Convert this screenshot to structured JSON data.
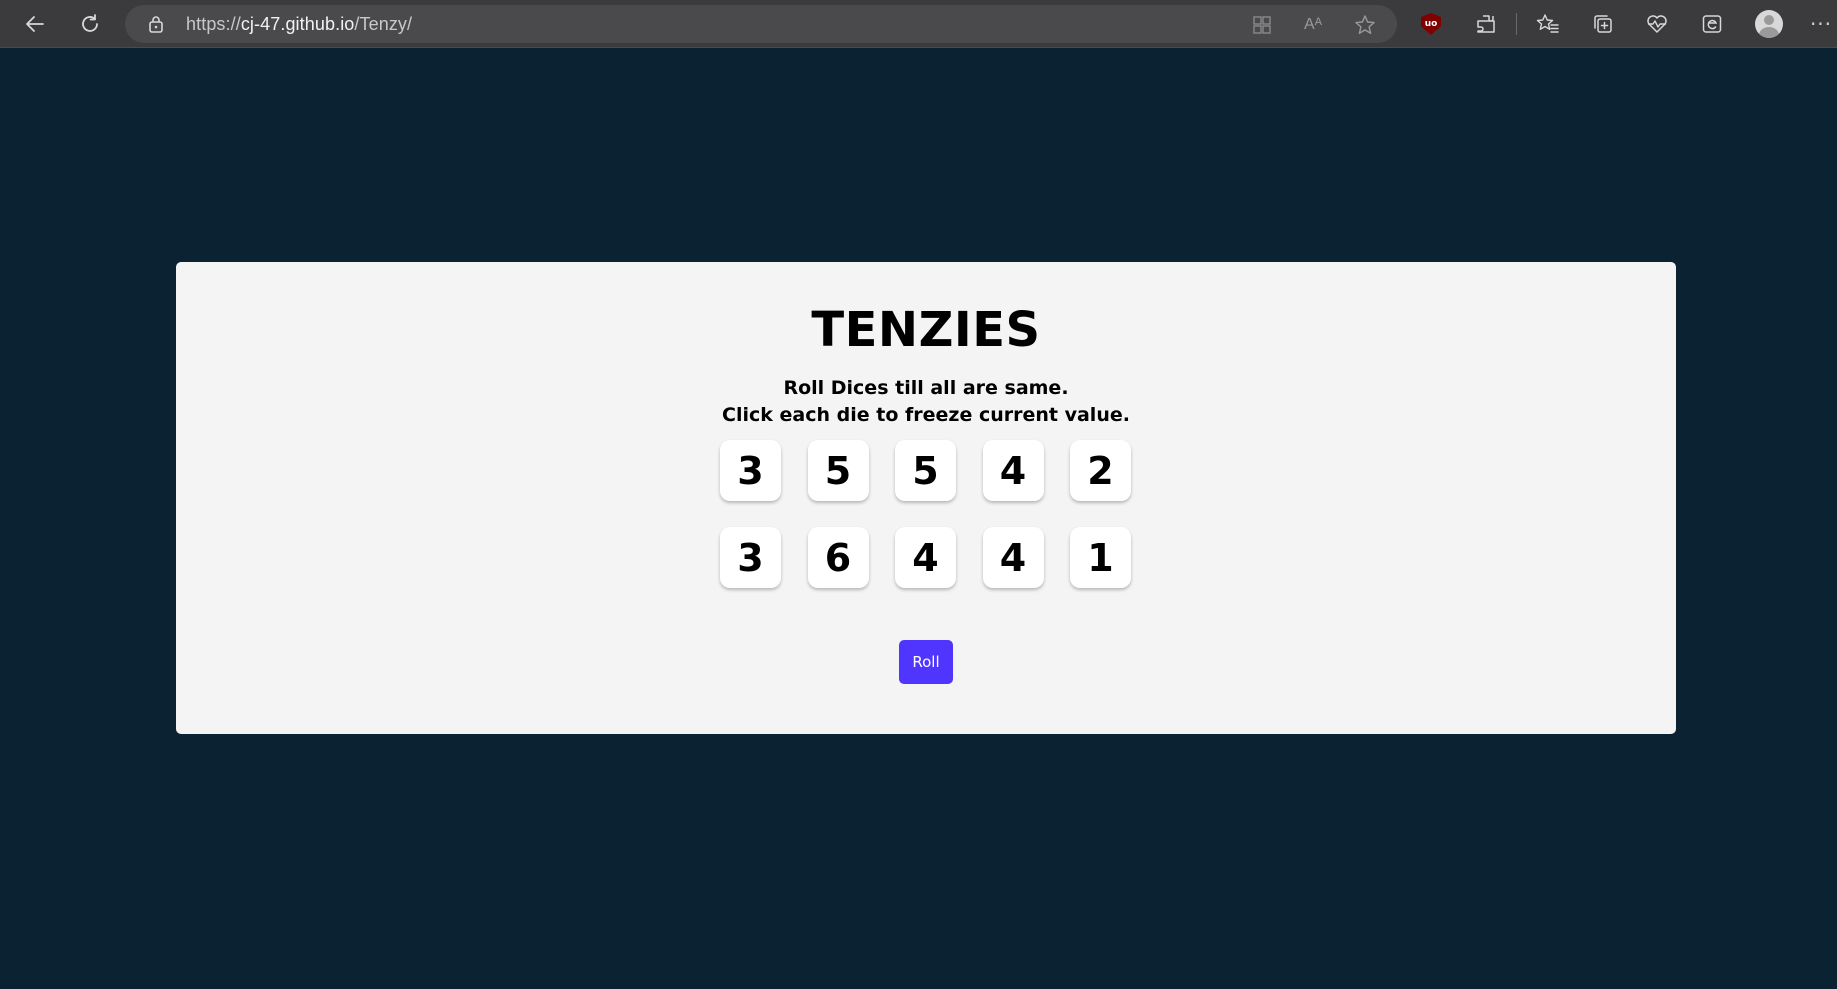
{
  "browser": {
    "url_scheme": "https://",
    "url_host": "cj-47.github.io",
    "url_path": "/Tenzy/",
    "read_aloud_label": "Aᴬ",
    "ublock_label": "uo",
    "more_label": "···",
    "icons": [
      "back-icon",
      "refresh-icon",
      "lock-icon",
      "apps-icon",
      "read-aloud-icon",
      "favorite-star-icon",
      "ublock-icon",
      "extensions-icon",
      "favorites-icon",
      "collections-icon",
      "browser-essentials-icon",
      "edge-bar-icon",
      "profile-icon",
      "more-icon"
    ]
  },
  "app": {
    "title": "TENZIES",
    "instructions_line1": "Roll Dices till all are same.",
    "instructions_line2": "Click each die to freeze current value.",
    "dice": [
      "3",
      "5",
      "5",
      "4",
      "2",
      "3",
      "6",
      "4",
      "4",
      "1"
    ],
    "roll_label": "Roll"
  },
  "colors": {
    "page_background": "#0b2233",
    "card_background": "#f4f4f4",
    "die_background": "#ffffff",
    "roll_button": "#5035ff",
    "browser_chrome": "#3b3b3d"
  }
}
